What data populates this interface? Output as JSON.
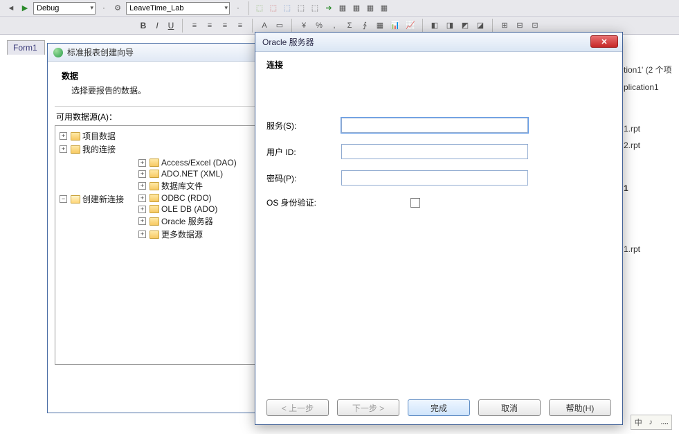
{
  "toolbar": {
    "config": "Debug",
    "project": "LeaveTime_Lab"
  },
  "doc_tab": "Form1",
  "wizard": {
    "title": "标准报表创建向导",
    "header": "数据",
    "subheader": "选择要报告的数据。",
    "available_label": "可用数据源(A)：",
    "tree": {
      "n0": "项目数据",
      "n1": "我的连接",
      "n2": "创建新连接",
      "n2_0": "Access/Excel (DAO)",
      "n2_1": "ADO.NET (XML)",
      "n2_2": "数据库文件",
      "n2_3": "ODBC (RDO)",
      "n2_4": "OLE DB (ADO)",
      "n2_5": "Oracle 服务器",
      "n2_6": "更多数据源"
    },
    "btn_prev": "< 上一步"
  },
  "oracle": {
    "title": "Oracle 服务器",
    "section": "连接",
    "service_label": "服务(S):",
    "user_label": "用户 ID:",
    "pwd_label": "密码(P):",
    "osauth_label": "OS 身份验证:",
    "service_value": "",
    "user_value": "",
    "pwd_value": "",
    "btn_prev": "< 上一步",
    "btn_next": "下一步 >",
    "btn_finish": "完成",
    "btn_cancel": "取消",
    "btn_help": "帮助(H)"
  },
  "right": {
    "l1": "tion1' (2 个项",
    "l2": "plication1",
    "l3": "1.rpt",
    "l4": "2.rpt",
    "l5": "1",
    "l6": "1.rpt"
  },
  "ime": {
    "a": "中",
    "b": "♪",
    "c": "᠁"
  }
}
